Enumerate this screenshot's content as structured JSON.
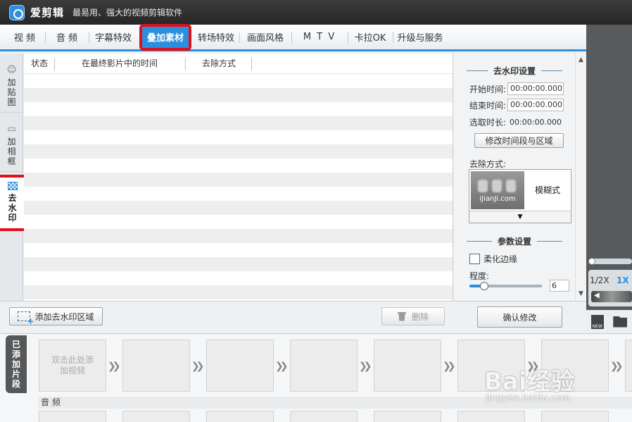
{
  "app": {
    "name": "爱剪辑",
    "slogan": "最易用、强大的视频剪辑软件"
  },
  "tabs": [
    {
      "label": "视  频"
    },
    {
      "label": "音  频"
    },
    {
      "label": "字幕特效"
    },
    {
      "label": "叠加素材",
      "active": true
    },
    {
      "label": "转场特效"
    },
    {
      "label": "画面风格"
    },
    {
      "label": "M T V"
    },
    {
      "label": "卡拉OK"
    },
    {
      "label": "升级与服务"
    }
  ],
  "side_tabs": [
    {
      "label": "加贴图",
      "icon": "sticker-icon"
    },
    {
      "label": "加相框",
      "icon": "frame-icon"
    },
    {
      "label": "去水印",
      "icon": "watermark-icon",
      "active": true
    }
  ],
  "list": {
    "columns": [
      "状态",
      "在最终影片中的时间",
      "去除方式"
    ]
  },
  "settings": {
    "title": "去水印设置",
    "start_label": "开始时间:",
    "start_value": "00:00:00.000",
    "end_label": "结束时间:",
    "end_value": "00:00:00.000",
    "duration_label": "选取时长:",
    "duration_value": "00:00:00.000",
    "modify_button": "修改时间段与区域",
    "mode_label": "去除方式:",
    "mode_site": "iJianJi.com",
    "mode_name": "模糊式",
    "dropdown_glyph": "▼",
    "params_title": "参数设置",
    "soften_label": "柔化边缘",
    "soften_checked": false,
    "degree_label": "程度:",
    "degree_value": "6",
    "degree_fraction": 0.2,
    "confirm_button": "确认修改"
  },
  "actions": {
    "add_button": "添加去水印区域",
    "delete_button": "删除"
  },
  "preview": {
    "speed_half": "1/2X",
    "speed_1x": "1X",
    "new_icon_text": "NEW"
  },
  "clips": {
    "added_label": "已添加片段",
    "placeholder": "双击此处添加视频",
    "audio_label": "音 频"
  },
  "watermark": {
    "brand": "Bai经验",
    "url": "jingyan.baidu.com"
  },
  "colors": {
    "accent": "#2b8fe0",
    "highlight": "#e0101b",
    "titlebar": "#2b2b2b"
  }
}
